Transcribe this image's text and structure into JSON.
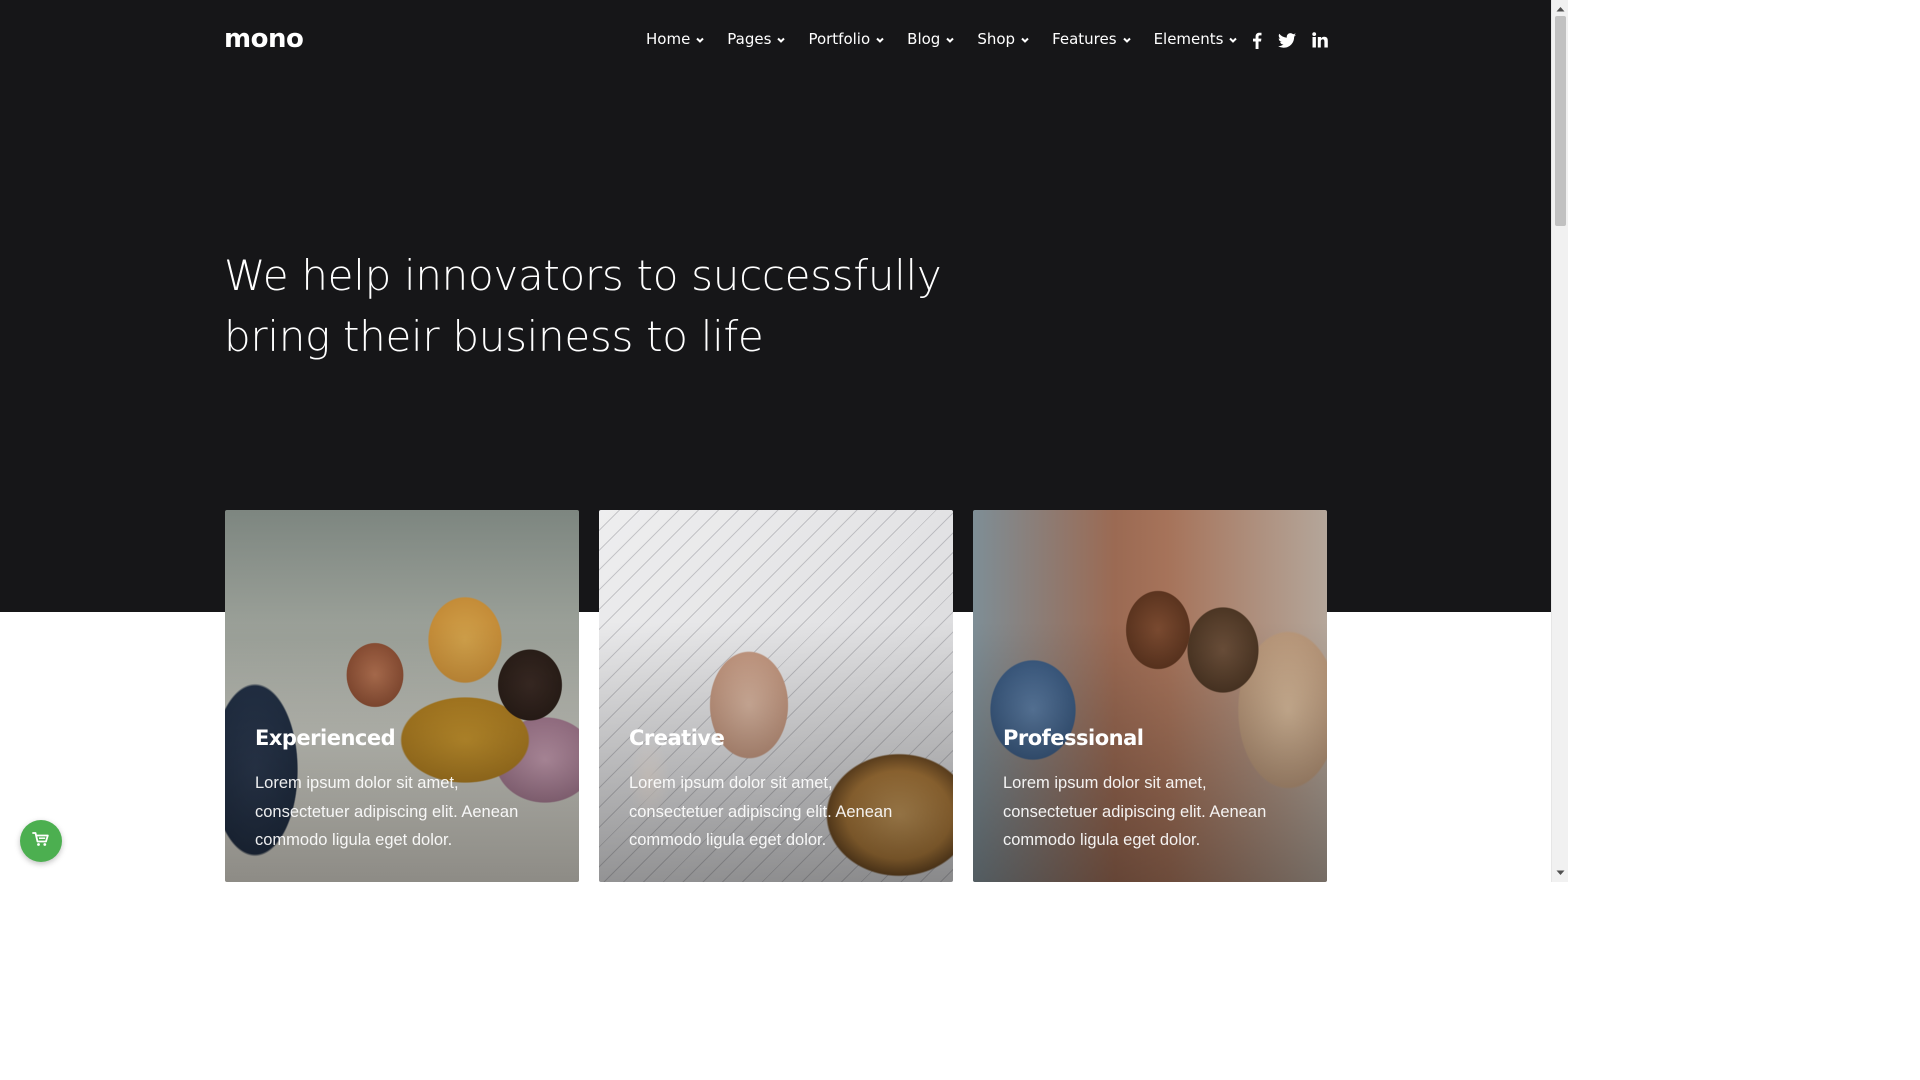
{
  "brand": {
    "logo": "mono"
  },
  "nav": {
    "items": [
      {
        "label": "Home"
      },
      {
        "label": "Pages"
      },
      {
        "label": "Portfolio"
      },
      {
        "label": "Blog"
      },
      {
        "label": "Shop"
      },
      {
        "label": "Features"
      },
      {
        "label": "Elements"
      }
    ]
  },
  "social": {
    "icons": [
      "facebook-icon",
      "twitter-icon",
      "linkedin-icon"
    ]
  },
  "hero": {
    "headline_line1": "We help innovators to successfully",
    "headline_line2": "bring their business to life"
  },
  "cards": [
    {
      "title": "Experienced",
      "text": "Lorem ipsum dolor sit amet, consectetuer adipiscing elit. Aenean commodo ligula eget dolor."
    },
    {
      "title": "Creative",
      "text": "Lorem ipsum dolor sit amet, consectetuer adipiscing elit. Aenean commodo ligula eget dolor."
    },
    {
      "title": "Professional",
      "text": "Lorem ipsum dolor sit amet, consectetuer adipiscing elit. Aenean commodo ligula eget dolor."
    }
  ],
  "cart": {
    "icon": "cart-icon",
    "color": "#4caf50"
  },
  "colors": {
    "hero_bg": "#161618",
    "text": "#ffffff"
  }
}
